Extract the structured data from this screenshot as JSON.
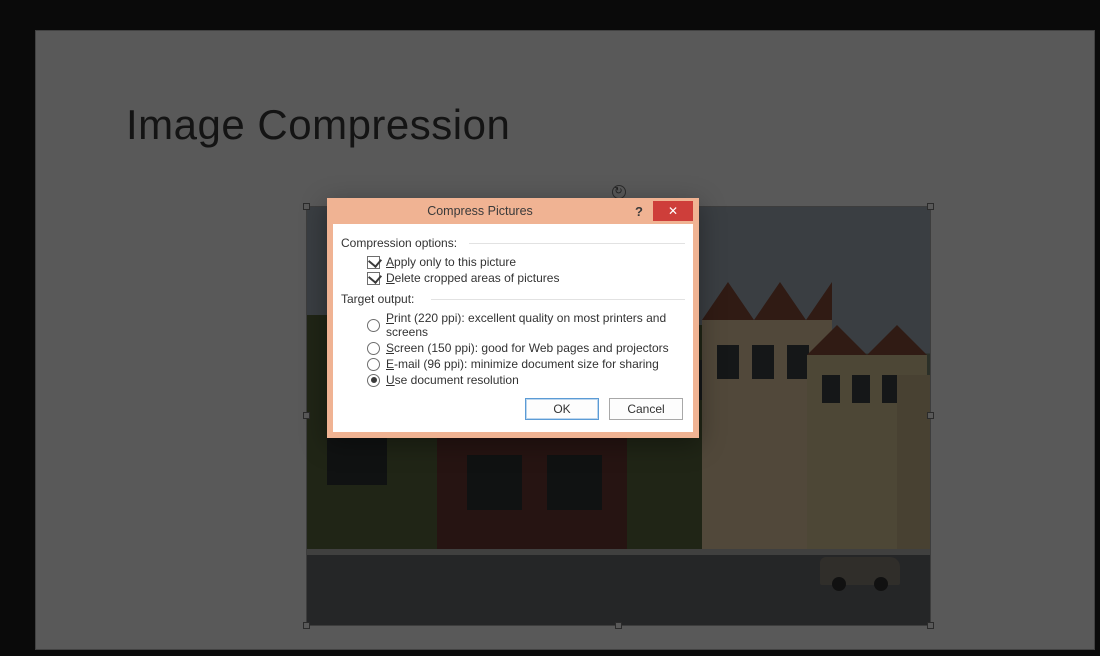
{
  "slide": {
    "title": "Image Compression"
  },
  "dialog": {
    "title": "Compress Pictures",
    "help_symbol": "?",
    "close_symbol": "✕",
    "group1_label": "Compression options:",
    "opt_apply": {
      "accel": "A",
      "rest": "pply only to this picture",
      "checked": true
    },
    "opt_delete": {
      "accel": "D",
      "rest": "elete cropped areas of pictures",
      "checked": true
    },
    "group2_label": "Target output:",
    "radios": [
      {
        "accel": "P",
        "rest": "rint (220 ppi): excellent quality on most printers and screens",
        "selected": false
      },
      {
        "accel": "S",
        "rest": "creen (150 ppi): good for Web pages and projectors",
        "selected": false
      },
      {
        "accel": "E",
        "rest": "-mail (96 ppi): minimize document size for sharing",
        "selected": false
      },
      {
        "accel": "U",
        "rest": "se document resolution",
        "selected": true
      }
    ],
    "ok_label": "OK",
    "cancel_label": "Cancel"
  }
}
